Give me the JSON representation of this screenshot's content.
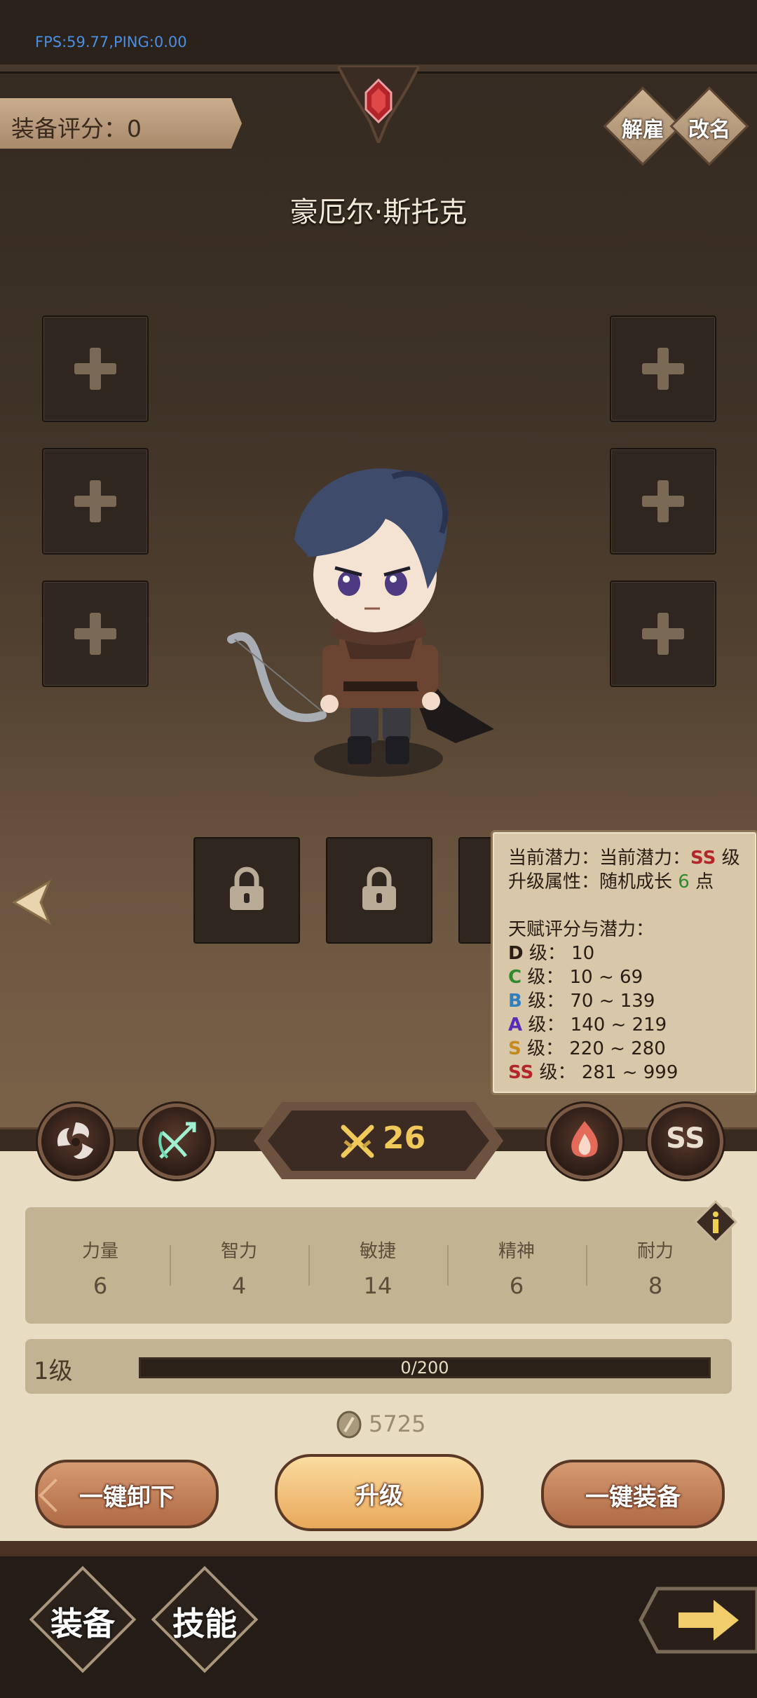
{
  "debug": {
    "fps_text": "FPS:59.77,PING:0.00"
  },
  "header": {
    "score_label": "装备评分：",
    "score_value": "0",
    "dismiss_label": "解雇",
    "rename_label": "改名"
  },
  "hero": {
    "name": "豪厄尔·斯托克"
  },
  "tooltip": {
    "line1_prefix": "当前潜力：当前潜力：",
    "line1_grade": "SS",
    "line1_suffix": "级",
    "line2_prefix": "升级属性：随机成长",
    "line2_value": "6",
    "line2_suffix": "点",
    "title": "天赋评分与潜力：",
    "grades": [
      {
        "grade": "D",
        "suffix": "级：",
        "range": "10",
        "color": "#2a1e14"
      },
      {
        "grade": "C",
        "suffix": "级：",
        "range": "10 ~ 69",
        "color": "#2f8a2e"
      },
      {
        "grade": "B",
        "suffix": "级：",
        "range": "70 ~ 139",
        "color": "#2f7ec0"
      },
      {
        "grade": "A",
        "suffix": "级：",
        "range": "140 ~ 219",
        "color": "#5a2ab8"
      },
      {
        "grade": "S",
        "suffix": "级：",
        "range": "220 ~ 280",
        "color": "#c58a1a"
      },
      {
        "grade": "SS",
        "suffix": "级：",
        "range": "281 ~ 999",
        "color": "#b3262a"
      }
    ]
  },
  "class_bar": {
    "power_value": "26",
    "grade_badge": "SS"
  },
  "stats": [
    {
      "name": "力量",
      "value": "6"
    },
    {
      "name": "智力",
      "value": "4"
    },
    {
      "name": "敏捷",
      "value": "14"
    },
    {
      "name": "精神",
      "value": "6"
    },
    {
      "name": "耐力",
      "value": "8"
    }
  ],
  "level": {
    "label": "1级",
    "xp_text": "0/200",
    "xp_fraction": 0
  },
  "gold": {
    "amount": "5725"
  },
  "actions": {
    "unequip_all": "一键卸下",
    "upgrade": "升级",
    "equip_all": "一键装备"
  },
  "nav": {
    "equipment": "装备",
    "skills": "技能"
  }
}
